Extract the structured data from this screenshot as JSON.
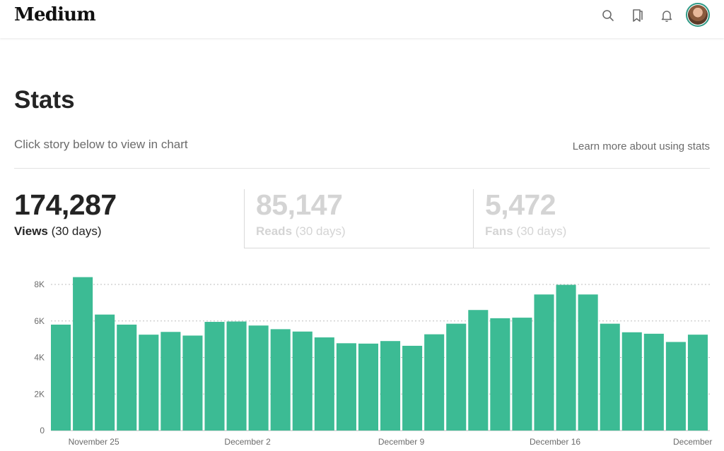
{
  "header": {
    "logo": "Medium",
    "icons": [
      "search-icon",
      "bookmarks-icon",
      "notifications-icon"
    ],
    "avatar_icon": "user-avatar",
    "avatar_ring_color": "#2f9a86"
  },
  "page": {
    "title": "Stats",
    "subtitle": "Click story below to view in chart",
    "learn_more": "Learn more about using stats"
  },
  "stats": [
    {
      "value": "174,287",
      "label": "Views",
      "period": "(30 days)",
      "active": true
    },
    {
      "value": "85,147",
      "label": "Reads",
      "period": "(30 days)",
      "active": false
    },
    {
      "value": "5,472",
      "label": "Fans",
      "period": "(30 days)",
      "active": false
    }
  ],
  "chart_data": {
    "type": "bar",
    "series_color": "#3cbb94",
    "grid": "dotted horizontal",
    "ylim": [
      0,
      8000
    ],
    "y_ticks": [
      {
        "value": 0,
        "label": "0"
      },
      {
        "value": 2000,
        "label": "2K"
      },
      {
        "value": 4000,
        "label": "4K"
      },
      {
        "value": 6000,
        "label": "6K"
      },
      {
        "value": 8000,
        "label": "8K"
      }
    ],
    "x_labels": [
      {
        "index": 2,
        "label": "November 25"
      },
      {
        "index": 9,
        "label": "December 2"
      },
      {
        "index": 16,
        "label": "December 9"
      },
      {
        "index": 23,
        "label": "December 16"
      },
      {
        "index": 30,
        "label": "December"
      }
    ],
    "values": [
      5800,
      8400,
      6350,
      5800,
      5250,
      5400,
      5200,
      5950,
      5970,
      5750,
      5550,
      5420,
      5100,
      4780,
      4760,
      4900,
      4640,
      5270,
      5850,
      6600,
      6150,
      6180,
      7450,
      7980,
      7450,
      5850,
      5380,
      5300,
      4850,
      5250
    ]
  }
}
